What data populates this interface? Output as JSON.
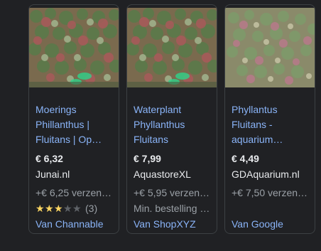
{
  "products": [
    {
      "title": "Moerings Phillanthus | Fluitans | Op…",
      "price": "€ 6,32",
      "store": "Junai.nl",
      "shipping": "+€ 6,25 verzen…",
      "rating": {
        "stars": 3,
        "max": 5,
        "count": "(3)"
      },
      "source": "Van Channable"
    },
    {
      "title": "Waterplant Phyllanthus Fluitans",
      "price": "€ 7,99",
      "store": "AquastoreXL",
      "shipping": "+€ 5,95 verzen…",
      "extra": "Min. bestelling …",
      "source": "Van ShopXYZ"
    },
    {
      "title": "Phyllantus Fluitans - aquarium…",
      "price": "€ 4,49",
      "store": "GDAquarium.nl",
      "shipping": "+€ 7,50 verzen…",
      "source": "Van Google"
    }
  ],
  "colors": {
    "background": "#202124",
    "link": "#8ab4f8",
    "text": "#e8eaed",
    "muted": "#9aa0a6",
    "star_on": "#fdd663",
    "star_off": "#5f6368"
  }
}
